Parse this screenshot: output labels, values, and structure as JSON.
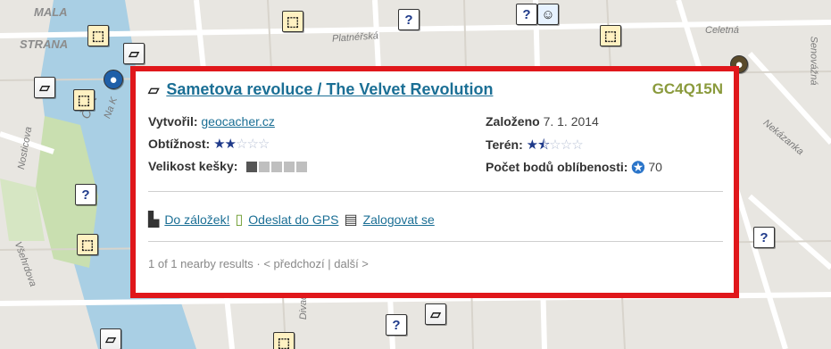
{
  "map": {
    "labels": {
      "mala": "MALA",
      "strana": "STRANA",
      "platnerska": "Platnéřská",
      "celetna": "Celetná",
      "senovazna": "Senovážná",
      "nekazanka": "Nekázanka",
      "nostic": "Nosticova",
      "vsehrd": "Všehrdova",
      "na_k": "Na K",
      "cert": "Čert",
      "divad": "Divad"
    }
  },
  "popup": {
    "cache_type_icon": "traditional-cache-icon",
    "title": "Sametova revoluce / The Velvet Revolution",
    "gc_code": "GC4Q15N",
    "author_label": "Vytvořil:",
    "author": "geocacher.cz",
    "founded_label": "Založeno",
    "founded": "7. 1. 2014",
    "difficulty_label": "Obtížnost:",
    "difficulty_stars": 2,
    "terrain_label": "Terén:",
    "terrain_stars": 1.5,
    "size_label": "Velikost kešky:",
    "size_level": 1,
    "favorites_label": "Počet bodů oblíbenosti:",
    "favorites_count": "70",
    "actions": {
      "bookmark": "Do záložek!",
      "send_gps": "Odeslat do GPS",
      "log": "Zalogovat se"
    },
    "paging": "1 of 1 nearby results · < předchozí | další >"
  },
  "colors": {
    "border": "#e0171b",
    "link": "#1b6f95",
    "gc_code": "#8a9a3c",
    "stars": "#1f3a8a"
  }
}
